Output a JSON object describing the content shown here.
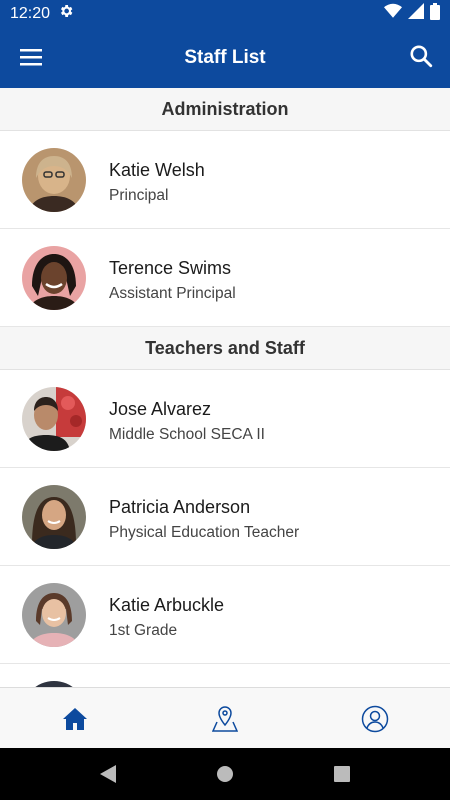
{
  "status_bar": {
    "time": "12:20"
  },
  "app_bar": {
    "title": "Staff List"
  },
  "sections": [
    {
      "title": "Administration",
      "people": [
        {
          "name": "Katie Welsh",
          "role": "Principal"
        },
        {
          "name": "Terence Swims",
          "role": "Assistant Principal"
        }
      ]
    },
    {
      "title": "Teachers and Staff",
      "people": [
        {
          "name": "Jose Alvarez",
          "role": "Middle School SECA II"
        },
        {
          "name": "Patricia Anderson",
          "role": "Physical Education Teacher"
        },
        {
          "name": "Katie Arbuckle",
          "role": "1st Grade"
        }
      ]
    }
  ],
  "bottom_nav": {
    "items": [
      {
        "icon": "home-icon",
        "active": true
      },
      {
        "icon": "map-pin-icon",
        "active": false
      },
      {
        "icon": "profile-icon",
        "active": false
      }
    ]
  },
  "colors": {
    "primary": "#0d4a9e",
    "section_bg": "#f6f6f6",
    "nav_bg": "#f8f8f8"
  }
}
